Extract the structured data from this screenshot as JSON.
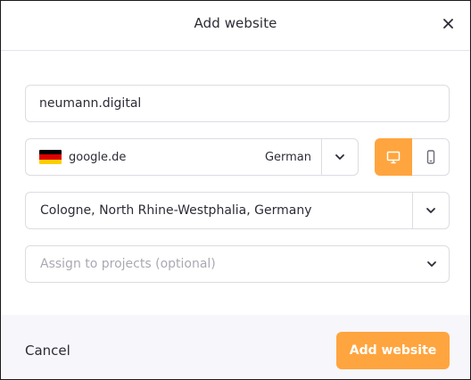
{
  "dialog": {
    "title": "Add website"
  },
  "domain_field": {
    "value": "neumann.digital"
  },
  "search_engine": {
    "name": "google.de",
    "language": "German",
    "flag_colors": [
      "#000000",
      "#dd0000",
      "#ffce00"
    ]
  },
  "device": {
    "options": [
      "desktop",
      "mobile"
    ],
    "selected": "desktop"
  },
  "location": {
    "value": "Cologne, North Rhine-Westphalia, Germany"
  },
  "projects": {
    "placeholder": "Assign to projects (optional)"
  },
  "footer": {
    "cancel_label": "Cancel",
    "submit_label": "Add website"
  },
  "colors": {
    "accent": "#ffa53f",
    "text": "#2c2c36",
    "border": "#dcdce3",
    "footer_bg": "#f7f6fa"
  },
  "icons": {
    "close": "close-icon",
    "chevron": "chevron-down-icon",
    "desktop": "desktop-icon",
    "mobile": "mobile-icon",
    "flag": "germany-flag-icon"
  }
}
